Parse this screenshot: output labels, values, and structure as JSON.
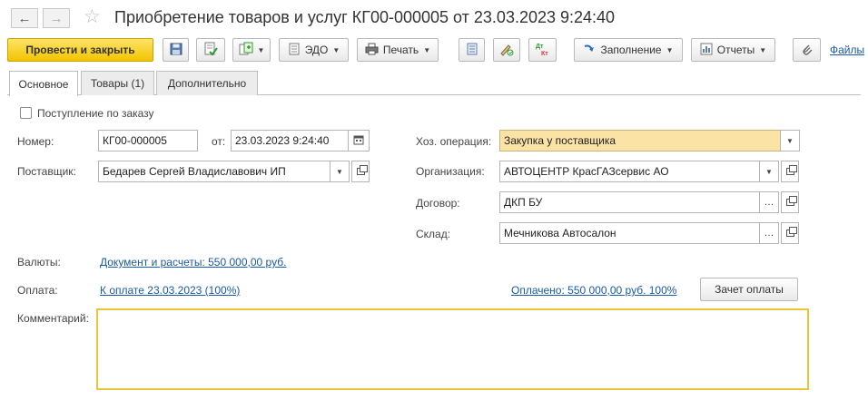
{
  "window": {
    "title": "Приобретение товаров и услуг КГ00-000005 от 23.03.2023 9:24:40",
    "back_icon": "arrow-left-icon",
    "forward_icon": "arrow-right-icon",
    "favorite_icon": "star-icon"
  },
  "toolbar": {
    "post_and_close": "Провести и закрыть",
    "edo": "ЭДО",
    "print": "Печать",
    "fill": "Заполнение",
    "reports": "Отчеты",
    "files": "Файлы"
  },
  "tabs": [
    {
      "label": "Основное",
      "active": true
    },
    {
      "label": "Товары (1)",
      "active": false
    },
    {
      "label": "Дополнительно",
      "active": false
    }
  ],
  "form": {
    "by_order_label": "Поступление по заказу",
    "by_order_checked": false,
    "number_label": "Номер:",
    "number_value": "КГ00-000005",
    "date_label": "от:",
    "date_value": "23.03.2023  9:24:40",
    "supplier_label": "Поставщик:",
    "supplier_value": "Бедарев Сергей Владиславович ИП",
    "operation_label": "Хоз. операция:",
    "operation_value": "Закупка у поставщика",
    "organization_label": "Организация:",
    "organization_value": "АВТОЦЕНТР КрасГАЗсервис АО",
    "contract_label": "Договор:",
    "contract_value": "ДКП БУ",
    "warehouse_label": "Склад:",
    "warehouse_value": "Мечникова Автосалон",
    "currency_label": "Валюты:",
    "currency_link": "Документ и расчеты: 550 000,00 руб.",
    "payment_label": "Оплата:",
    "payment_link": "К оплате 23.03.2023 (100%)",
    "paid_link": "Оплачено: 550 000,00 руб. 100%",
    "offset_button": "Зачет оплаты",
    "comment_label": "Комментарий:",
    "comment_value": ""
  },
  "colors": {
    "accent_yellow": "#f1c400",
    "operation_bg": "#fbe3a6",
    "link": "#1a5aa6",
    "comment_border": "#e8c53a"
  }
}
